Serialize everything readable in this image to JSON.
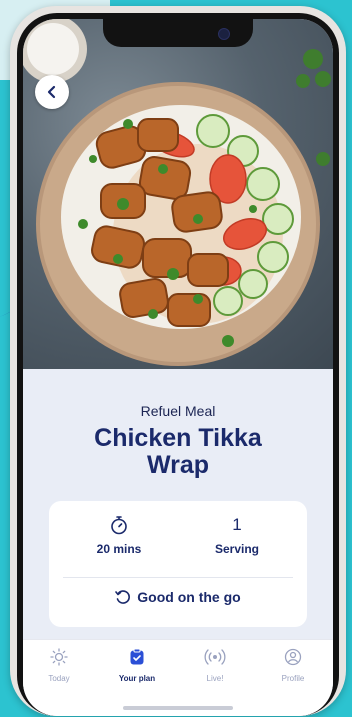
{
  "meal": {
    "category": "Refuel Meal",
    "title": "Chicken Tikka Wrap",
    "image": "chicken-tikka-wrap-photo"
  },
  "stats": {
    "time_value_icon": "stopwatch-icon",
    "time_label": "20 mins",
    "serving_value": "1",
    "serving_label": "Serving"
  },
  "tag": {
    "icon": "circular-arrow-icon",
    "label": "Good on the go"
  },
  "nav": {
    "back_icon": "chevron-left-icon"
  },
  "tabs": [
    {
      "label": "Today",
      "icon": "sun-icon"
    },
    {
      "label": "Your plan",
      "icon": "plan-icon"
    },
    {
      "label": "Live!",
      "icon": "broadcast-icon"
    },
    {
      "label": "Profile",
      "icon": "profile-icon"
    }
  ],
  "colors": {
    "brand_navy": "#1b2a6b",
    "background_teal": "#2cc3d0",
    "screen_bg": "#e9edf6",
    "accent_blue": "#2b4fd6"
  }
}
